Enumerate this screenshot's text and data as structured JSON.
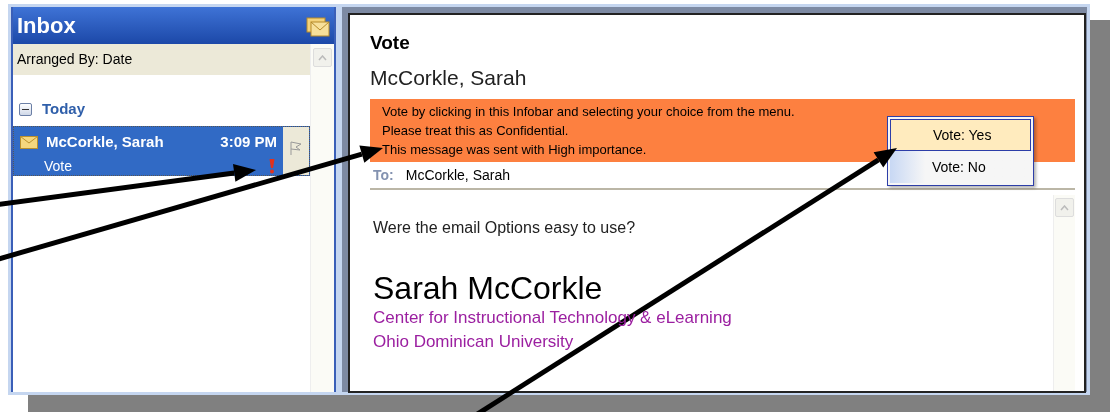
{
  "inbox": {
    "title": "Inbox",
    "arranged_by": "Arranged By: Date",
    "groups": [
      {
        "label": "Today",
        "expanded": true,
        "messages": [
          {
            "sender": "McCorkle, Sarah",
            "time": "3:09 PM",
            "subject": "Vote",
            "selected": true,
            "high_importance": true
          }
        ]
      }
    ]
  },
  "message": {
    "subject": "Vote",
    "sender": "McCorkle, Sarah",
    "infobar": [
      "Vote by clicking in this Infobar and selecting your choice from the menu.",
      "Please treat this as Confidential.",
      "This message was sent with High importance."
    ],
    "vote_menu": [
      {
        "label": "Vote: Yes",
        "selected": true
      },
      {
        "label": "Vote: No",
        "selected": false
      }
    ],
    "to_label": "To:",
    "to": "McCorkle, Sarah",
    "body": "Were the email Options easy to use?",
    "signature": {
      "name": "Sarah McCorkle",
      "lines": [
        "Center for Instructional Technology & eLearning",
        "Ohio Dominican University"
      ]
    }
  }
}
